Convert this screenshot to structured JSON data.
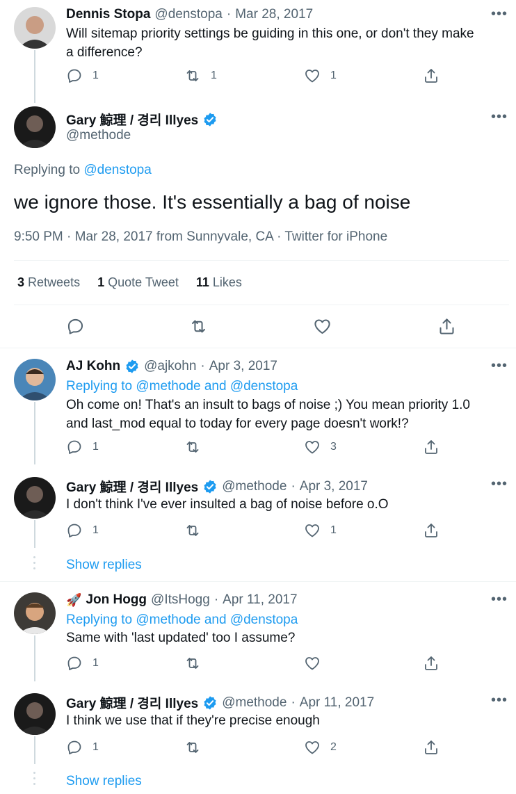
{
  "tweets": [
    {
      "name": "Dennis Stopa",
      "handle": "@denstopa",
      "date": "Mar 28, 2017",
      "text_line1": "Will sitemap priority settings be guiding in this one, or don't they make",
      "text_line2": "a difference?",
      "replies": "1",
      "retweets": "1",
      "likes": "1"
    },
    {
      "name": "AJ Kohn",
      "handle": "@ajkohn",
      "date": "Apr 3, 2017",
      "replying_prefix": "Replying to",
      "replying_to": "@methode and @denstopa",
      "text_line1": "Oh come on! That's an insult to bags of noise ;) You mean priority 1.0",
      "text_line2": "and last_mod equal to today for every page doesn't work!?",
      "replies": "1",
      "retweets": "",
      "likes": "3"
    },
    {
      "name": "Gary 鯨理 / 경리 Illyes",
      "handle": "@methode",
      "date": "Apr 3, 2017",
      "text_line1": "I don't think I've ever insulted a bag of noise before o.O",
      "replies": "1",
      "retweets": "",
      "likes": "1"
    },
    {
      "emoji": "🚀",
      "name": "Jon Hogg",
      "handle": "@ItsHogg",
      "date": "Apr 11, 2017",
      "replying_prefix": "Replying to",
      "replying_to": "@methode and @denstopa",
      "text_line1": "Same with 'last updated' too I assume?",
      "replies": "1",
      "retweets": "",
      "likes": ""
    },
    {
      "name": "Gary 鯨理 / 경리 Illyes",
      "handle": "@methode",
      "date": "Apr 11, 2017",
      "text_line1": "I think we use that if they're precise enough",
      "replies": "1",
      "retweets": "",
      "likes": "2"
    }
  ],
  "main_tweet": {
    "name": "Gary 鯨理 / 경리 Illyes",
    "handle": "@methode",
    "replying_prefix": "Replying to",
    "replying_to": "@denstopa",
    "text": "we ignore those. It's essentially a bag of noise",
    "meta": "9:50 PM · Mar 28, 2017 from Sunnyvale, CA · Twitter for iPhone",
    "retweets_count": "3",
    "retweets_label": "Retweets",
    "quotes_count": "1",
    "quotes_label": "Quote Tweet",
    "likes_count": "11",
    "likes_label": "Likes"
  },
  "show_replies_label": "Show replies",
  "more_label": "•••",
  "colors": {
    "accent": "#1d9bf0",
    "text": "#0f1419",
    "secondary": "#536471",
    "line": "#cfd9de"
  }
}
